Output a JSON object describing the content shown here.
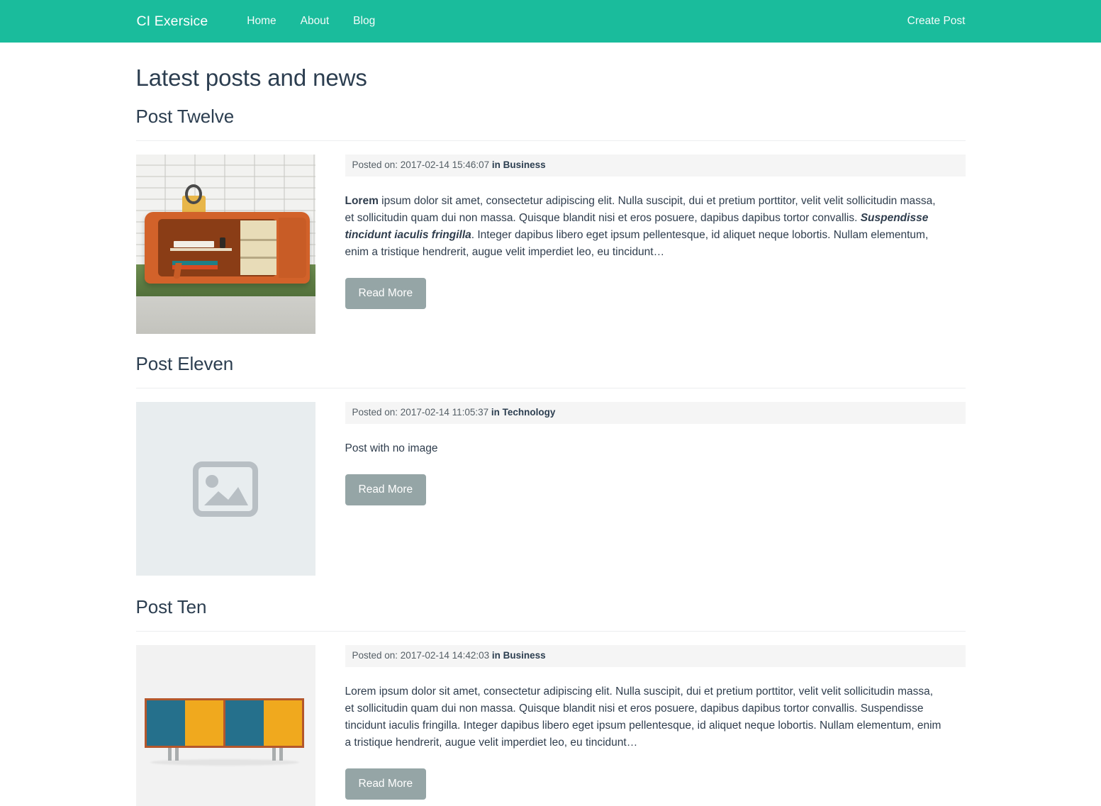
{
  "navbar": {
    "brand": "CI Exersice",
    "links": [
      {
        "label": "Home",
        "name": "nav-link-home"
      },
      {
        "label": "About",
        "name": "nav-link-about"
      },
      {
        "label": "Blog",
        "name": "nav-link-blog"
      }
    ],
    "create_post": "Create Post",
    "background_color": "#1abc9c"
  },
  "main": {
    "page_title": "Latest posts and news",
    "read_more_label": "Read More",
    "read_more_color": "#95a5a6",
    "meta_prefix": "Posted on: ",
    "posts": [
      {
        "title": "Post Twelve",
        "meta_date": "Posted on: 2017-02-14 15:46:07 ",
        "meta_category": "in Business",
        "body_lead": "Lorem",
        "body_part1": " ipsum dolor sit amet, consectetur adipiscing elit. Nulla suscipit, dui et pretium porttitor, velit velit sollicitudin massa, et sollicitudin quam dui non massa. Quisque blandit nisi et eros posuere, dapibus dapibus tortor convallis. ",
        "body_emphasis": "Suspendisse tincidunt iaculis fringilla",
        "body_part2": ". Integer dapibus libero eget ipsum pellentesque, id aliquet neque lobortis. Nullam elementum, enim a tristique hendrerit, augue velit imperdiet leo, eu tincidunt…",
        "image": "orange-credenza-photo",
        "read_more": "Read More"
      },
      {
        "title": "Post Eleven",
        "meta_date": "Posted on: 2017-02-14 11:05:37 ",
        "meta_category": "in Technology",
        "body_plain": "Post with no image",
        "image": "no-image-placeholder",
        "read_more": "Read More"
      },
      {
        "title": "Post Ten",
        "meta_date": "Posted on: 2017-02-14 14:42:03 ",
        "meta_category": "in Business",
        "body_plain": "Lorem ipsum dolor sit amet, consectetur adipiscing elit. Nulla suscipit, dui et pretium porttitor, velit velit sollicitudin massa, et sollicitudin quam dui non massa. Quisque blandit nisi et eros posuere, dapibus dapibus tortor convallis. Suspendisse tincidunt iaculis fringilla. Integer dapibus libero eget ipsum pellentesque, id aliquet neque lobortis. Nullam elementum, enim a tristique hendrerit, augue velit imperdiet leo, eu tincidunt…",
        "image": "blue-yellow-credenza-photo",
        "read_more": "Read More"
      }
    ]
  }
}
